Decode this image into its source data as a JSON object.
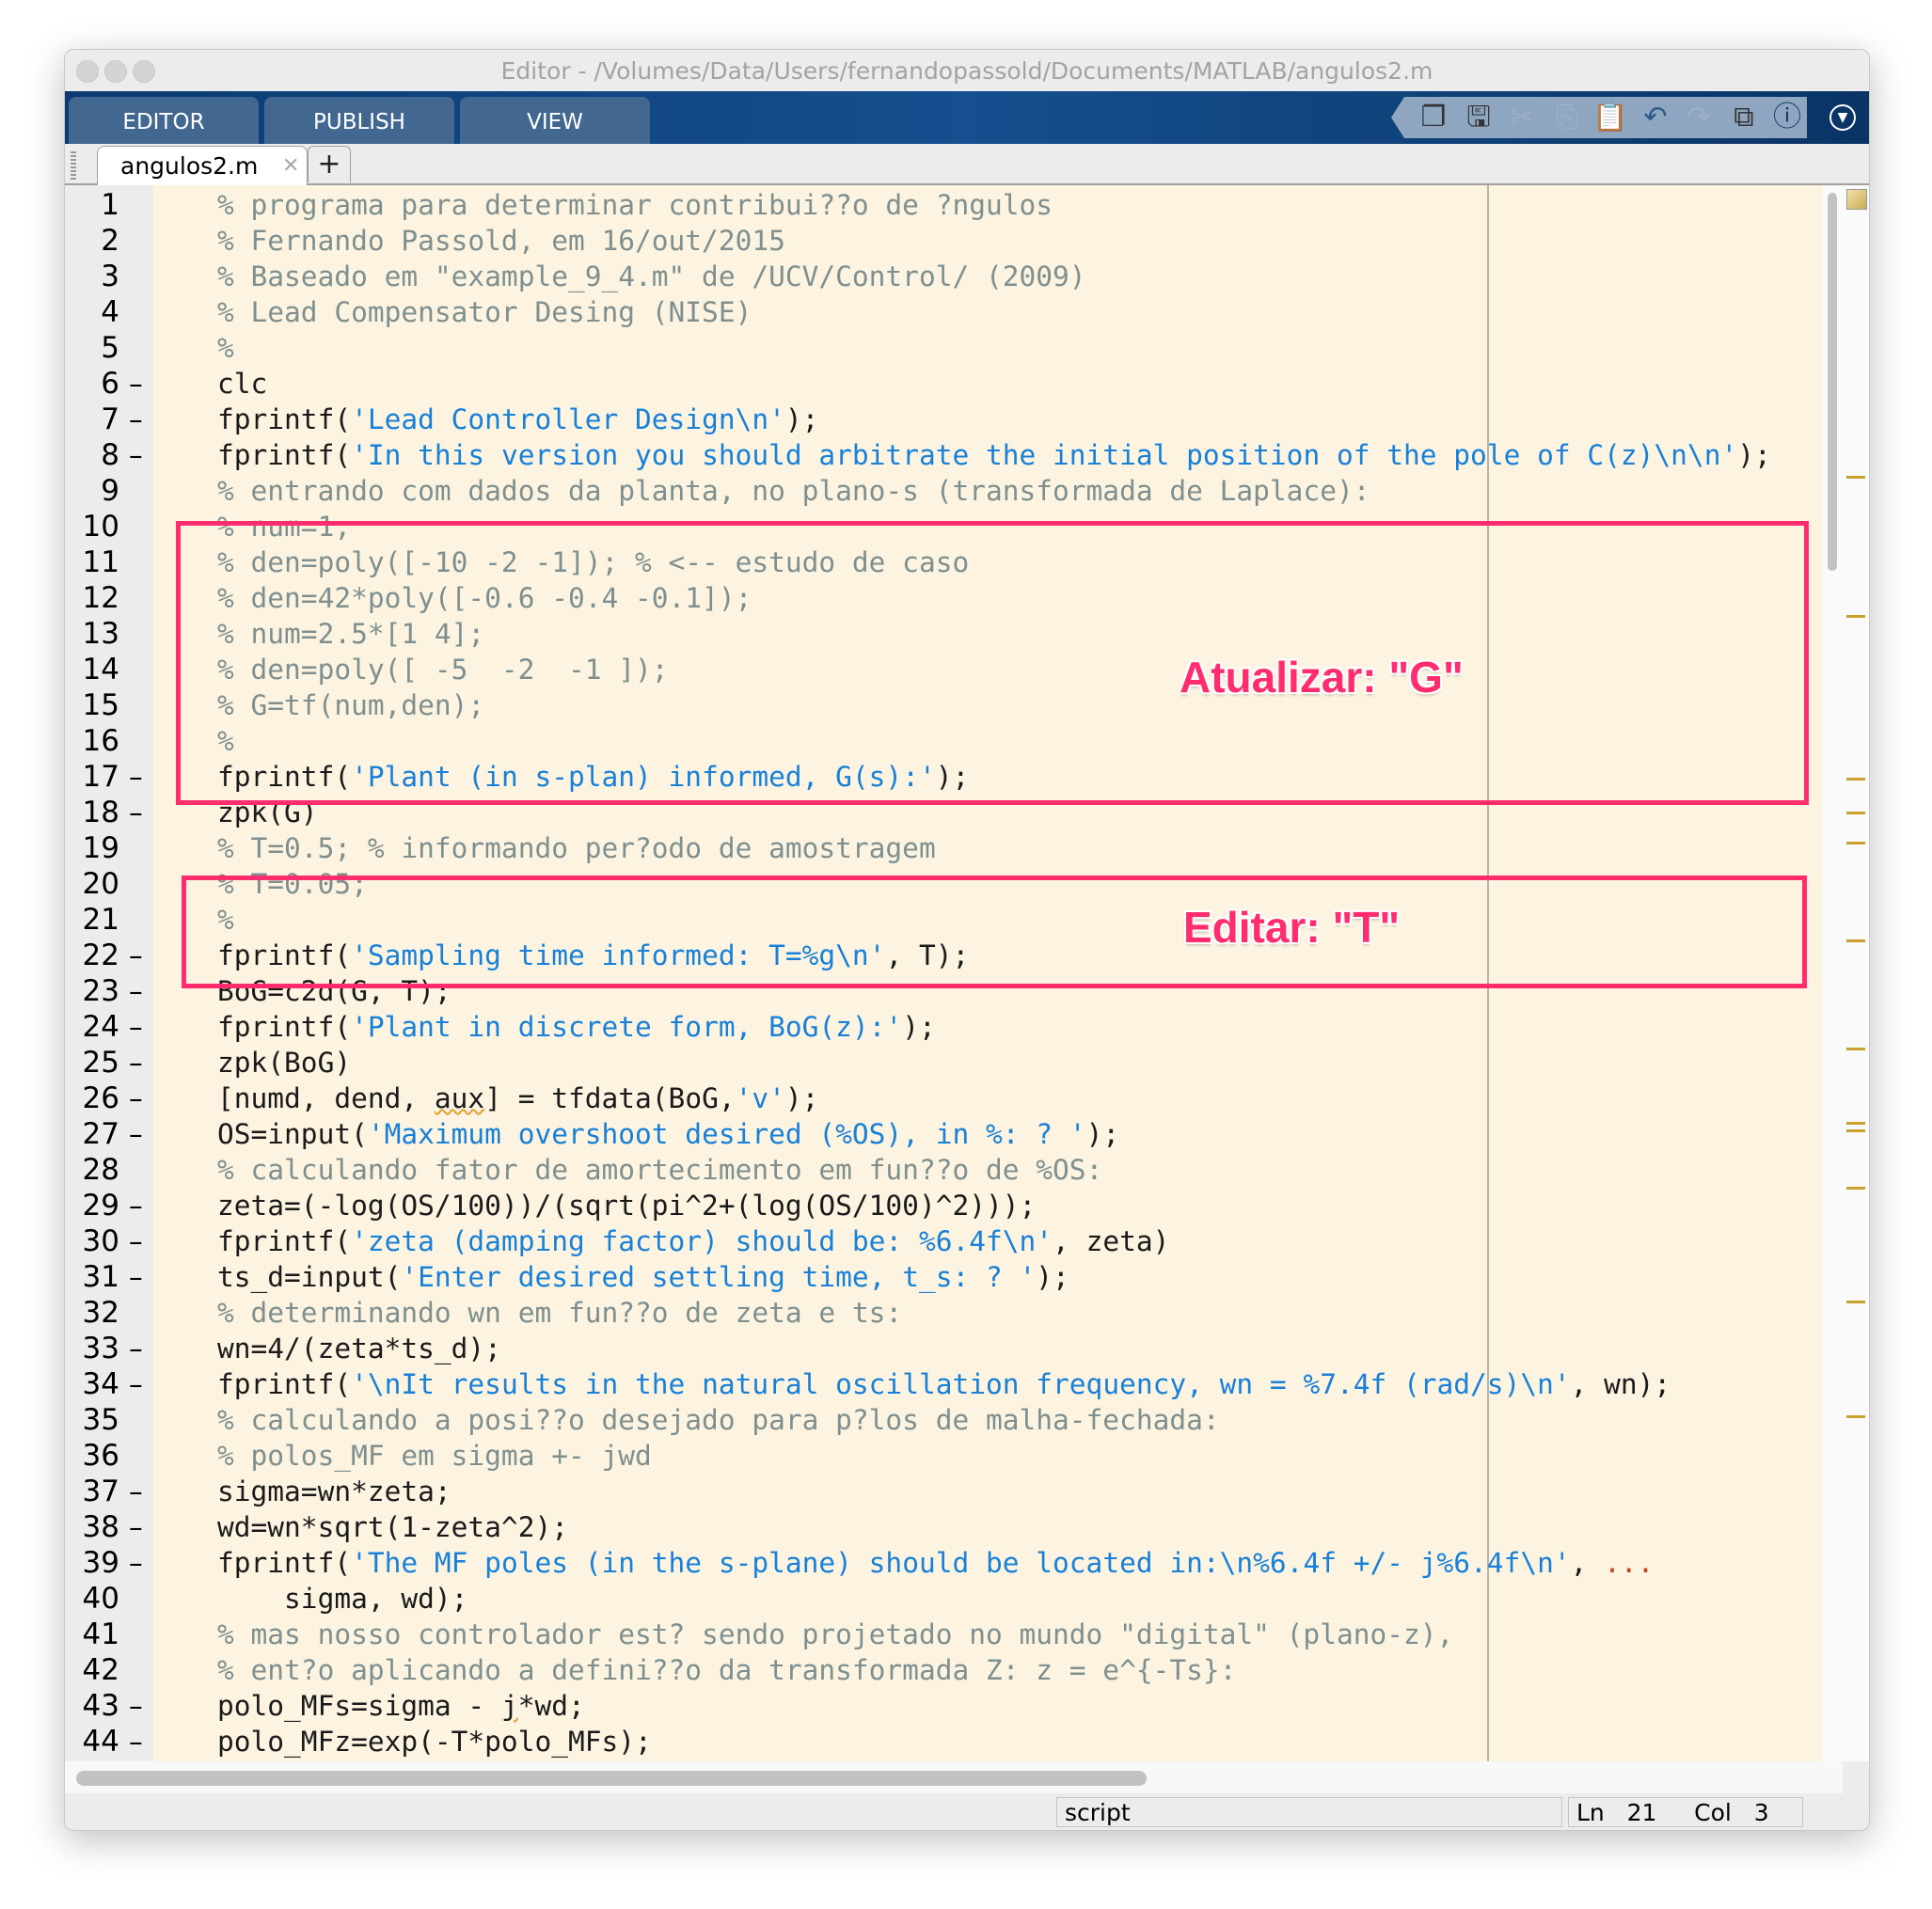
{
  "window": {
    "title": "Editor - /Volumes/Data/Users/fernandopassold/Documents/MATLAB/angulos2.m"
  },
  "ribbon": {
    "tabs": [
      "EDITOR",
      "PUBLISH",
      "VIEW"
    ]
  },
  "quick_access": [
    "new-live-script-icon",
    "save-icon",
    "cut-icon",
    "copy-icon",
    "paste-icon",
    "undo-icon",
    "redo-icon",
    "switch-windows-icon",
    "help-icon"
  ],
  "file_tab": {
    "label": "angulos2.m",
    "close": "✕",
    "add": "+"
  },
  "code": {
    "lines": [
      {
        "n": "1",
        "dash": false,
        "seg": [
          [
            "c",
            "% programa para determinar contribui??o de ?ngulos"
          ]
        ]
      },
      {
        "n": "2",
        "dash": false,
        "seg": [
          [
            "c",
            "% Fernando Passold, em 16/out/2015"
          ]
        ]
      },
      {
        "n": "3",
        "dash": false,
        "seg": [
          [
            "c",
            "% Baseado em \"example_9_4.m\" de /UCV/Control/ (2009)"
          ]
        ]
      },
      {
        "n": "4",
        "dash": false,
        "seg": [
          [
            "c",
            "% Lead Compensator Desing (NISE)"
          ]
        ]
      },
      {
        "n": "5",
        "dash": false,
        "seg": [
          [
            "c",
            "%"
          ]
        ]
      },
      {
        "n": "6",
        "dash": true,
        "seg": [
          [
            "n",
            "clc"
          ]
        ]
      },
      {
        "n": "7",
        "dash": true,
        "seg": [
          [
            "n",
            "fprintf("
          ],
          [
            "s",
            "'Lead Controller Design\\n'"
          ],
          [
            "n",
            ");"
          ]
        ]
      },
      {
        "n": "8",
        "dash": true,
        "seg": [
          [
            "n",
            "fprintf("
          ],
          [
            "s",
            "'In this version you should arbitrate the initial position of the pole of C(z)\\n\\n'"
          ],
          [
            "n",
            ");"
          ]
        ]
      },
      {
        "n": "9",
        "dash": false,
        "seg": [
          [
            "c",
            "% entrando com dados da planta, no plano-s (transformada de Laplace):"
          ]
        ]
      },
      {
        "n": "10",
        "dash": false,
        "seg": [
          [
            "c",
            "% num=1;"
          ]
        ]
      },
      {
        "n": "11",
        "dash": false,
        "seg": [
          [
            "c",
            "% den=poly([-10 -2 -1]); % <-- estudo de caso"
          ]
        ]
      },
      {
        "n": "12",
        "dash": false,
        "seg": [
          [
            "c",
            "% den=42*poly([-0.6 -0.4 -0.1]);"
          ]
        ]
      },
      {
        "n": "13",
        "dash": false,
        "seg": [
          [
            "c",
            "% num=2.5*[1 4];"
          ]
        ]
      },
      {
        "n": "14",
        "dash": false,
        "seg": [
          [
            "c",
            "% den=poly([ -5  -2  -1 ]);"
          ]
        ]
      },
      {
        "n": "15",
        "dash": false,
        "seg": [
          [
            "c",
            "% G=tf(num,den);"
          ]
        ]
      },
      {
        "n": "16",
        "dash": false,
        "seg": [
          [
            "c",
            "%"
          ]
        ]
      },
      {
        "n": "17",
        "dash": true,
        "seg": [
          [
            "n",
            "fprintf("
          ],
          [
            "s",
            "'Plant (in s-plan) informed, G(s):'"
          ],
          [
            "n",
            ");"
          ]
        ]
      },
      {
        "n": "18",
        "dash": true,
        "seg": [
          [
            "n",
            "zpk(G)"
          ]
        ]
      },
      {
        "n": "19",
        "dash": false,
        "seg": [
          [
            "c",
            "% T=0.5; % informando per?odo de amostragem"
          ]
        ]
      },
      {
        "n": "20",
        "dash": false,
        "seg": [
          [
            "c",
            "% T=0.05;"
          ]
        ]
      },
      {
        "n": "21",
        "dash": false,
        "seg": [
          [
            "c",
            "%"
          ]
        ]
      },
      {
        "n": "22",
        "dash": true,
        "seg": [
          [
            "n",
            "fprintf("
          ],
          [
            "s",
            "'Sampling time informed: T=%g\\n'"
          ],
          [
            "n",
            ", T);"
          ]
        ]
      },
      {
        "n": "23",
        "dash": true,
        "seg": [
          [
            "n",
            "BoG=c2d(G, T);"
          ]
        ]
      },
      {
        "n": "24",
        "dash": true,
        "seg": [
          [
            "n",
            "fprintf("
          ],
          [
            "s",
            "'Plant in discrete form, BoG(z):'"
          ],
          [
            "n",
            ");"
          ]
        ]
      },
      {
        "n": "25",
        "dash": true,
        "seg": [
          [
            "n",
            "zpk(BoG)"
          ]
        ]
      },
      {
        "n": "26",
        "dash": true,
        "seg": [
          [
            "n",
            "[numd, dend, "
          ],
          [
            "w",
            "aux"
          ],
          [
            "n",
            "] = tfdata(BoG,"
          ],
          [
            "s",
            "'v'"
          ],
          [
            "n",
            ");"
          ]
        ]
      },
      {
        "n": "27",
        "dash": true,
        "seg": [
          [
            "n",
            "OS=input("
          ],
          [
            "s",
            "'Maximum overshoot desired (%OS), in %: ? '"
          ],
          [
            "n",
            ");"
          ]
        ]
      },
      {
        "n": "28",
        "dash": false,
        "seg": [
          [
            "c",
            "% calculando fator de amortecimento em fun??o de %OS:"
          ]
        ]
      },
      {
        "n": "29",
        "dash": true,
        "seg": [
          [
            "n",
            "zeta=(-log(OS/100))/(sqrt(pi^2+(log(OS/100)^2)));"
          ]
        ]
      },
      {
        "n": "30",
        "dash": true,
        "seg": [
          [
            "n",
            "fprintf("
          ],
          [
            "s",
            "'zeta (damping factor) should be: %6.4f\\n'"
          ],
          [
            "n",
            ", zeta)"
          ]
        ]
      },
      {
        "n": "31",
        "dash": true,
        "seg": [
          [
            "n",
            "ts_d=input("
          ],
          [
            "s",
            "'Enter desired settling time, t_s: ? '"
          ],
          [
            "n",
            ");"
          ]
        ]
      },
      {
        "n": "32",
        "dash": false,
        "seg": [
          [
            "c",
            "% determinando wn em fun??o de zeta e ts:"
          ]
        ]
      },
      {
        "n": "33",
        "dash": true,
        "seg": [
          [
            "n",
            "wn=4/(zeta*ts_d);"
          ]
        ]
      },
      {
        "n": "34",
        "dash": true,
        "seg": [
          [
            "n",
            "fprintf("
          ],
          [
            "s",
            "'\\nIt results in the natural oscillation frequency, wn = %7.4f (rad/s)\\n'"
          ],
          [
            "n",
            ", wn);"
          ]
        ]
      },
      {
        "n": "35",
        "dash": false,
        "seg": [
          [
            "c",
            "% calculando a posi??o desejado para p?los de malha-fechada:"
          ]
        ]
      },
      {
        "n": "36",
        "dash": false,
        "seg": [
          [
            "c",
            "% polos_MF em sigma +- jwd"
          ]
        ]
      },
      {
        "n": "37",
        "dash": true,
        "seg": [
          [
            "n",
            "sigma=wn*zeta;"
          ]
        ]
      },
      {
        "n": "38",
        "dash": true,
        "seg": [
          [
            "n",
            "wd=wn*sqrt(1-zeta^2);"
          ]
        ]
      },
      {
        "n": "39",
        "dash": true,
        "seg": [
          [
            "n",
            "fprintf("
          ],
          [
            "s",
            "'The MF poles (in the s-plane) should be located in:\\n%6.4f +/- j%6.4f\\n'"
          ],
          [
            "n",
            ", "
          ],
          [
            "k",
            "..."
          ]
        ]
      },
      {
        "n": "40",
        "dash": false,
        "seg": [
          [
            "n",
            "    sigma, wd);"
          ]
        ]
      },
      {
        "n": "41",
        "dash": false,
        "seg": [
          [
            "c",
            "% mas nosso controlador est? sendo projetado no mundo \"digital\" (plano-z),"
          ]
        ]
      },
      {
        "n": "42",
        "dash": false,
        "seg": [
          [
            "c",
            "% ent?o aplicando a defini??o da transformada Z: z = e^{-Ts}:"
          ]
        ]
      },
      {
        "n": "43",
        "dash": true,
        "seg": [
          [
            "n",
            "polo_MFs=sigma - "
          ],
          [
            "w",
            "j"
          ],
          [
            "n",
            "*wd;"
          ]
        ]
      },
      {
        "n": "44",
        "dash": true,
        "seg": [
          [
            "n",
            "polo_MFz=exp(-T*polo_MFs);"
          ]
        ]
      }
    ]
  },
  "annotations": {
    "box1_label": "Atualizar: \"G\"",
    "box2_label": "Editar: \"T\""
  },
  "status": {
    "mode": "script",
    "ln_label": "Ln",
    "ln": "21",
    "col_label": "Col",
    "col": "3"
  },
  "colors": {
    "annotation": "#ff2d6e",
    "comment": "#7f8f8f",
    "string": "#1880d8",
    "editor_bg": "#fcf4e1",
    "toolstrip": "#0b3b72"
  }
}
